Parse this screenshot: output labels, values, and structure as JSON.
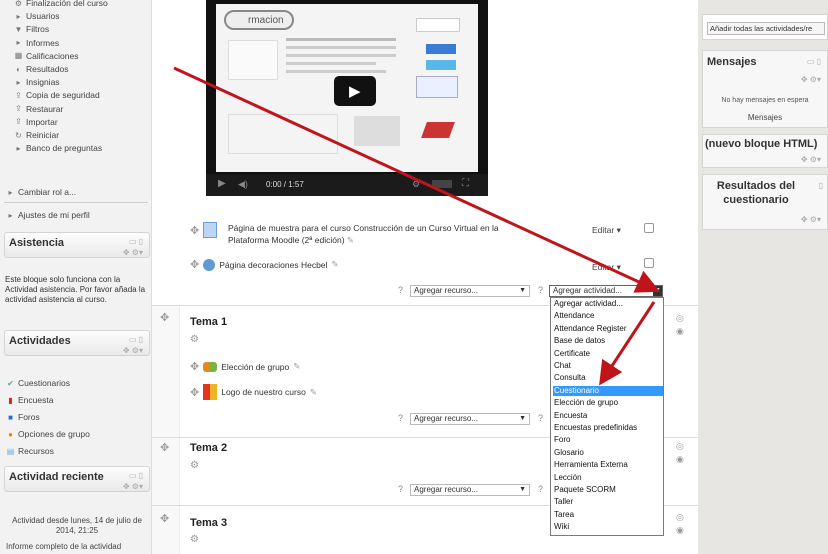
{
  "left_nav": {
    "items": [
      {
        "label": "Finalización del curso",
        "icon": "gear-icon"
      },
      {
        "label": "Usuarios",
        "icon": "triangle-right-icon"
      },
      {
        "label": "Filtros",
        "icon": "filter-icon"
      },
      {
        "label": "Informes",
        "icon": "triangle-right-icon"
      },
      {
        "label": "Calificaciones",
        "icon": "grades-icon"
      },
      {
        "label": "Resultados",
        "icon": "results-icon"
      },
      {
        "label": "Insignias",
        "icon": "triangle-right-icon"
      },
      {
        "label": "Copia de seguridad",
        "icon": "backup-icon"
      },
      {
        "label": "Restaurar",
        "icon": "restore-icon"
      },
      {
        "label": "Importar",
        "icon": "import-icon"
      },
      {
        "label": "Reiniciar",
        "icon": "reset-icon"
      },
      {
        "label": "Banco de preguntas",
        "icon": "triangle-right-icon"
      }
    ],
    "cambiar_rol": "Cambiar rol a...",
    "ajustes_perfil": "Ajustes de mi perfil"
  },
  "asistencia": {
    "title": "Asistencia",
    "text": "Este bloque solo funciona con la Actividad asistencia. Por favor añada la actividad asistencia al curso."
  },
  "actividades": {
    "title": "Actividades",
    "items": [
      "Cuestionarios",
      "Encuesta",
      "Foros",
      "Opciones de grupo",
      "Recursos"
    ]
  },
  "actividad_reciente": {
    "title": "Actividad reciente",
    "since": "Actividad desde lunes, 14 de julio de 2014, 21:25",
    "report": "Informe completo de la actividad"
  },
  "video": {
    "time": "0:00 / 1:57",
    "logo_text": "rmacion"
  },
  "resources": [
    {
      "label": "Página de muestra para el curso Construcción de un Curso Virtual en la Plataforma Moodle (2ª edición)"
    },
    {
      "label": "Página decoraciones Hecbel"
    }
  ],
  "editar_label": "Editar",
  "agregar_recurso": "Agregar recurso...",
  "agregar_actividad": "Agregar actividad...",
  "sections": [
    {
      "title": "Tema 1",
      "activities": [
        "Elección de grupo",
        "Logo de nuestro curso"
      ]
    },
    {
      "title": "Tema 2",
      "activities": []
    },
    {
      "title": "Tema 3",
      "activities": []
    }
  ],
  "dropdown": {
    "options": [
      "Agregar actividad...",
      "Attendance",
      "Attendance Register",
      "Base de datos",
      "Certificate",
      "Chat",
      "Consulta",
      "Cuestionario",
      "Elección de grupo",
      "Encuesta",
      "Encuestas predefinidas",
      "Foro",
      "Glosario",
      "Herramienta Externa",
      "Lección",
      "Paquete SCORM",
      "Taller",
      "Tarea",
      "Wiki"
    ],
    "highlighted": "Cuestionario"
  },
  "right": {
    "add_all": "Añadir todas las actividades/re",
    "mensajes_title": "Mensajes",
    "mensajes_empty": "No hay mensajes en espera",
    "mensajes_link": "Mensajes",
    "html_block_title": "(nuevo bloque HTML)",
    "resultados_title": "Resultados del cuestionario"
  },
  "colors": {
    "arrow": "#c0141b",
    "highlight": "#3399ff"
  }
}
